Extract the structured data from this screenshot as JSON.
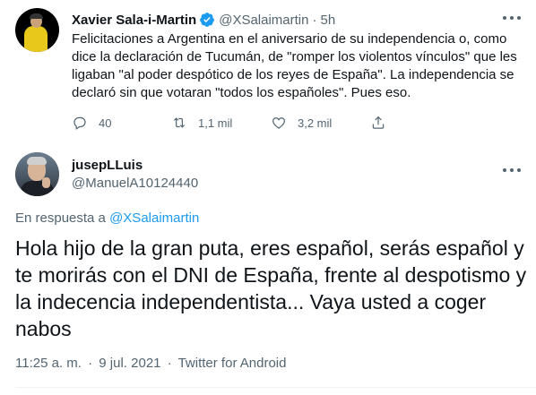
{
  "original_tweet": {
    "display_name": "Xavier Sala-i-Martin",
    "handle": "@XSalaimartin",
    "separator": "·",
    "time_ago": "5h",
    "text": "Felicitaciones a Argentina en el aniversario de su independencia o, como\ndice la declaración de Tucumán, de \"romper los violentos vínculos\" que les\nligaban \"al poder despótico de los reyes de España\". La independencia se\ndeclaró sin que votaran \"todos los españoles\". Pues eso.",
    "reply_count": "40",
    "retweet_count": "1,1 mil",
    "like_count": "3,2 mil",
    "verified_color": "#1d9bf0"
  },
  "reply_tweet": {
    "display_name": "jusepLLuis",
    "handle": "@ManuelA10124440",
    "replying_prefix": "En respuesta a",
    "replying_to": "@XSalaimartin",
    "text": "Hola hijo de la gran puta, eres español, serás español y\nte morirás con el DNI de España, frente al despotismo y\nla indecencia independentista... Vaya usted a coger\nnabos",
    "time": "11:25 a. m.",
    "separator": "·",
    "date": "9 jul. 2021",
    "source": "Twitter for Android"
  },
  "icons": {
    "reply": "reply-icon",
    "retweet": "retweet-icon",
    "like": "heart-icon",
    "share": "share-icon",
    "more": "more-icon",
    "verified": "verified-badge-icon"
  },
  "colors": {
    "text_primary": "#0f1419",
    "text_secondary": "#536471",
    "link": "#1d9bf0"
  }
}
